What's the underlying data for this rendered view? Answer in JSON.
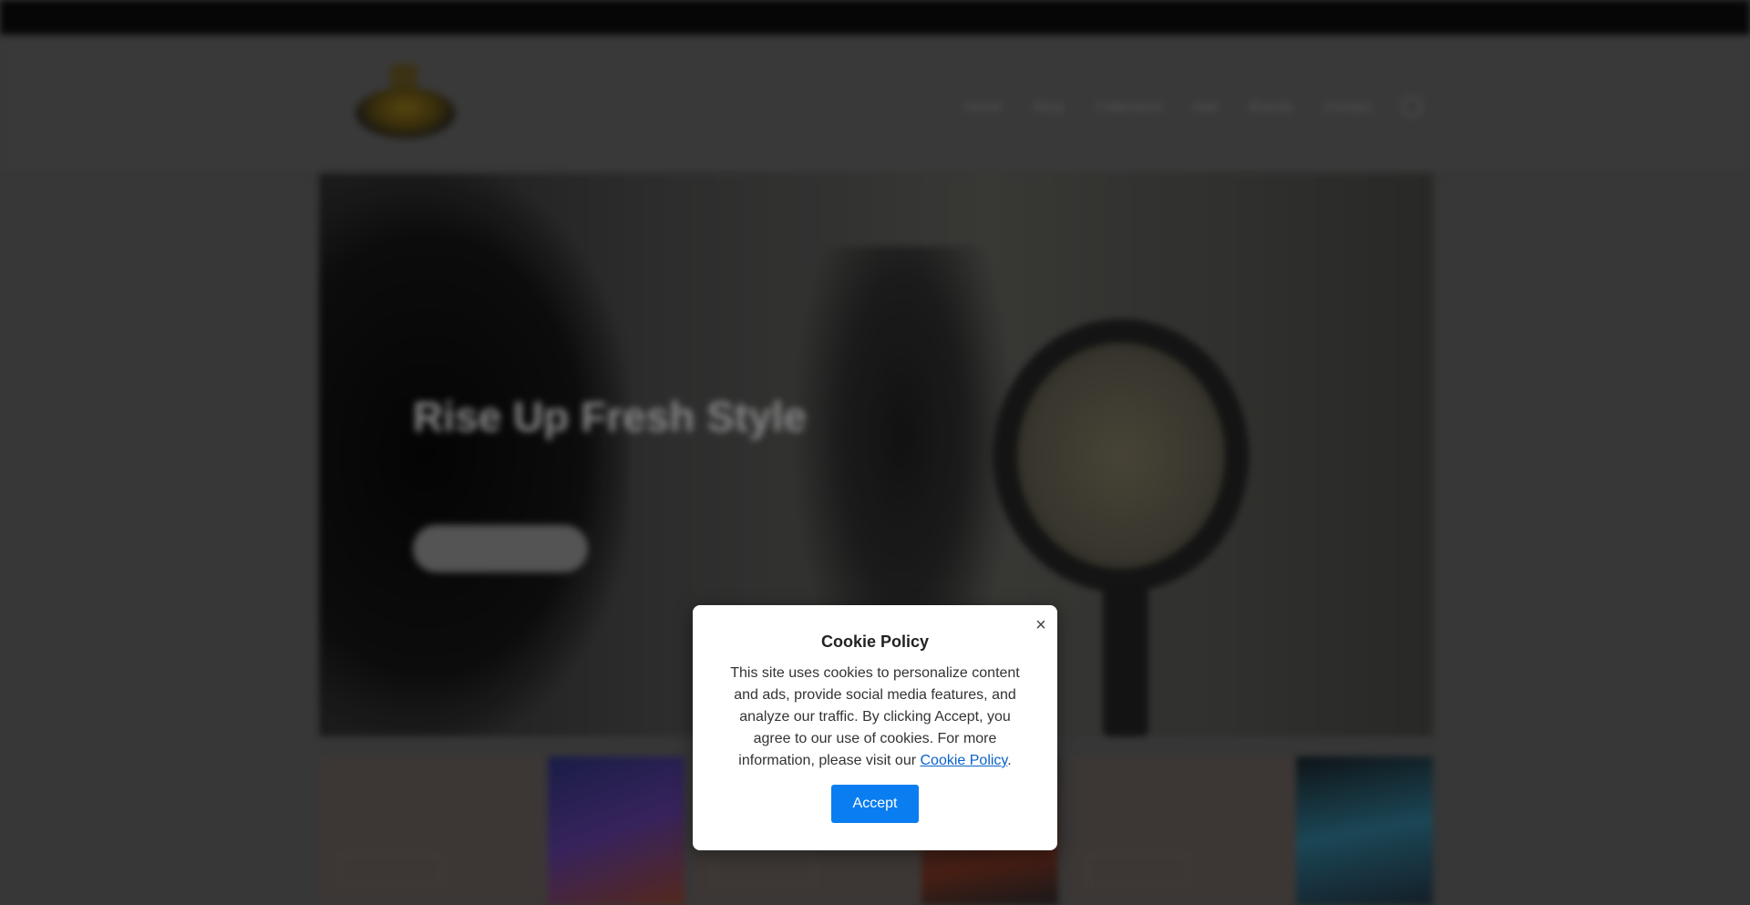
{
  "topbar": {
    "text": ""
  },
  "header": {
    "nav": [
      "Home",
      "Shop",
      "Collections",
      "Hair",
      "Brands",
      "Contact"
    ],
    "account_icon": "user-icon"
  },
  "hero": {
    "title": "Rise Up Fresh Style",
    "button_label": "",
    "link_label": ""
  },
  "promos": [
    {
      "title": "",
      "button_label": ""
    },
    {
      "title": "",
      "button_label": ""
    },
    {
      "title": "",
      "button_label": ""
    }
  ],
  "cookie_dialog": {
    "title": "Cookie Policy",
    "body_text": "This site uses cookies to personalize content and ads, provide social media features, and analyze our traffic. By clicking Accept, you agree to our use of cookies. For more information, please visit our ",
    "link_text": "Cookie Policy",
    "trailing": ".",
    "accept_label": "Accept",
    "close_glyph": "×"
  },
  "colors": {
    "accept": "#0a7df0",
    "link": "#0a63c9",
    "dialog_bg": "#ffffff"
  }
}
